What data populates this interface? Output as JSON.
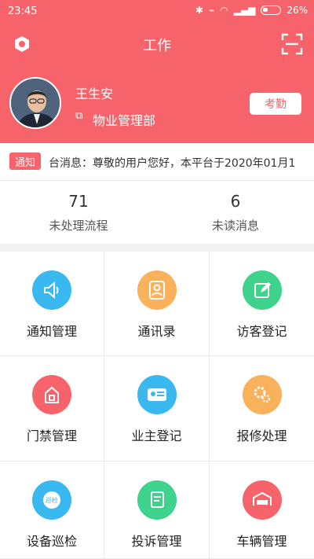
{
  "statusbar": {
    "time": "23:45",
    "battery": "26%"
  },
  "header": {
    "title": "工作"
  },
  "user": {
    "name": "王生安",
    "department": "物业管理部",
    "checkin_label": "考勤"
  },
  "notice": {
    "tag": "通知",
    "text": "台消息：尊敬的用户您好，本平台于2020年01月1"
  },
  "stats": [
    {
      "value": "71",
      "label": "未处理流程"
    },
    {
      "value": "6",
      "label": "未读消息"
    }
  ],
  "grid": [
    {
      "label": "通知管理",
      "icon": "speaker-icon",
      "color": "#3ab8f0"
    },
    {
      "label": "通讯录",
      "icon": "contact-icon",
      "color": "#f9b15b"
    },
    {
      "label": "访客登记",
      "icon": "edit-icon",
      "color": "#3fd28c"
    },
    {
      "label": "门禁管理",
      "icon": "lock-icon",
      "color": "#f7636a"
    },
    {
      "label": "业主登记",
      "icon": "id-card-icon",
      "color": "#3ab8f0"
    },
    {
      "label": "报修处理",
      "icon": "gears-icon",
      "color": "#f9b15b"
    },
    {
      "label": "设备巡检",
      "icon": "inspection-icon",
      "color": "#3ab8f0"
    },
    {
      "label": "投诉管理",
      "icon": "complaint-icon",
      "color": "#3fd28c"
    },
    {
      "label": "车辆管理",
      "icon": "vehicle-icon",
      "color": "#f7636a"
    }
  ],
  "grid_icon_text": {
    "inspection": "巡检"
  }
}
